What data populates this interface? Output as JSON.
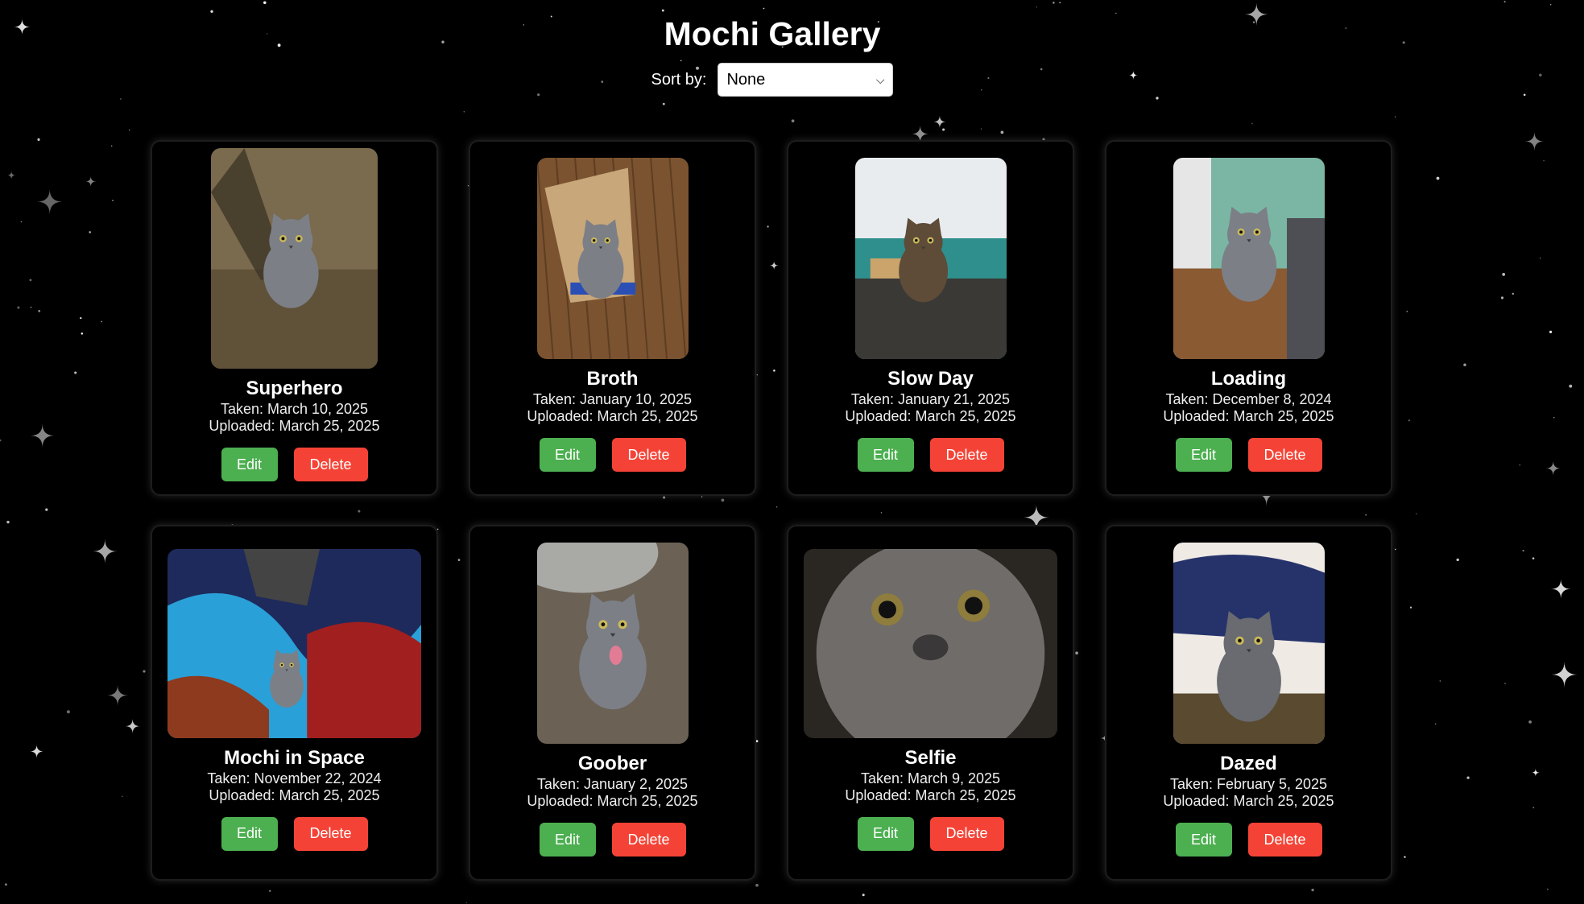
{
  "app": {
    "title": "Mochi Gallery",
    "sort_label": "Sort by:",
    "sort_value": "None"
  },
  "buttons": {
    "edit": "Edit",
    "delete": "Delete"
  },
  "colors": {
    "background": "#000000",
    "edit_button": "#4caf50",
    "delete_button": "#f44336"
  },
  "photos": [
    {
      "title": "Superhero",
      "taken": "Taken: March 10, 2025",
      "uploaded": "Uploaded: March 25, 2025",
      "orientation": "portrait-tall",
      "scene": "cat-standing-grass"
    },
    {
      "title": "Broth",
      "taken": "Taken: January 10, 2025",
      "uploaded": "Uploaded: March 25, 2025",
      "orientation": "portrait",
      "scene": "cat-in-box"
    },
    {
      "title": "Slow Day",
      "taken": "Taken: January 21, 2025",
      "uploaded": "Uploaded: March 25, 2025",
      "orientation": "portrait",
      "scene": "cat-on-couch"
    },
    {
      "title": "Loading",
      "taken": "Taken: December 8, 2024",
      "uploaded": "Uploaded: March 25, 2025",
      "orientation": "portrait",
      "scene": "cat-sitting-floor"
    },
    {
      "title": "Mochi in Space",
      "taken": "Taken: November 22, 2024",
      "uploaded": "Uploaded: March 25, 2025",
      "orientation": "landscape",
      "scene": "cat-in-blankets"
    },
    {
      "title": "Goober",
      "taken": "Taken: January 2, 2025",
      "uploaded": "Uploaded: March 25, 2025",
      "orientation": "portrait",
      "scene": "cat-tongue-out"
    },
    {
      "title": "Selfie",
      "taken": "Taken: March 9, 2025",
      "uploaded": "Uploaded: March 25, 2025",
      "orientation": "landscape",
      "scene": "cat-closeup"
    },
    {
      "title": "Dazed",
      "taken": "Taken: February 5, 2025",
      "uploaded": "Uploaded: March 25, 2025",
      "orientation": "portrait",
      "scene": "cat-lying-pillow"
    }
  ]
}
